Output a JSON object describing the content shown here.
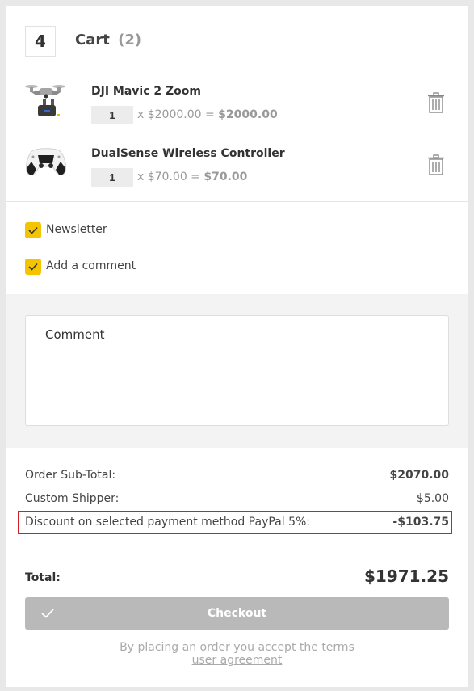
{
  "header": {
    "step": "4",
    "title": "Cart",
    "count": "(2)"
  },
  "items": [
    {
      "name": "DJI Mavic 2 Zoom",
      "qty": "1",
      "calc": "x $2000.00 =",
      "line_total": "$2000.00",
      "icon": "drone-image"
    },
    {
      "name": "DualSense Wireless Controller",
      "qty": "1",
      "calc": "x $70.00 =",
      "line_total": "$70.00",
      "icon": "gamepad-image"
    }
  ],
  "options": [
    {
      "label": "Newsletter",
      "checked": true
    },
    {
      "label": "Add a comment",
      "checked": true
    }
  ],
  "comment": {
    "placeholder": "Comment"
  },
  "summary": {
    "subtotal_label": "Order Sub-Total:",
    "subtotal_value": "$2070.00",
    "shipper_label": "Custom Shipper:",
    "shipper_value": "$5.00",
    "discount_label": "Discount on selected payment method PayPal 5%:",
    "discount_value": "-$103.75",
    "total_label": "Total:",
    "total_value": "$1971.25"
  },
  "checkout": {
    "label": "Checkout"
  },
  "terms": {
    "text": "By placing an order you accept the terms",
    "link": "user agreement"
  },
  "colors": {
    "accent": "#f5c400",
    "highlight_border": "#d31f26",
    "button_disabled": "#b9b9b9"
  }
}
